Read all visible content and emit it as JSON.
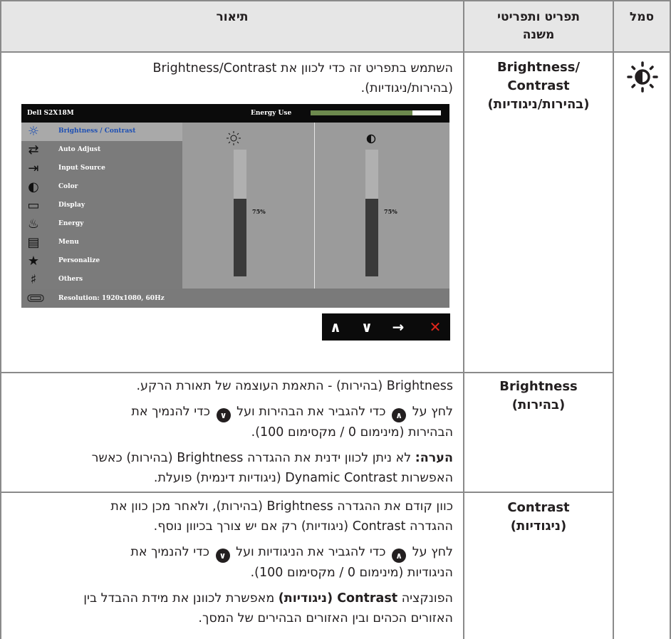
{
  "header": {
    "symbol": "סמל",
    "menu_line1": "תפריט ותפריטי",
    "menu_line2": "משנה",
    "description": "תיאור"
  },
  "rows": {
    "brightness_contrast": {
      "name_line1": "Brightness/",
      "name_line2": "Contrast",
      "name_line3": "(בהירות/ניגודיות)",
      "desc_line1": "השתמש בתפריט זה כדי לכוון את Brightness/Contrast",
      "desc_line2": "(בהירות/ניגודיות)."
    },
    "brightness": {
      "name_line1": "Brightness",
      "name_line2": "(בהירות)",
      "p1": "Brightness (בהירות) - התאמת העוצמה של תאורת הרקע.",
      "p2_a": "לחץ על",
      "p2_b": "כדי להגביר את הבהירות ועל",
      "p2_c": "כדי להנמיך את",
      "p2_line2": "הבהירות (מינימום 0 / מקסימום 100).",
      "note_bold": "הערה:",
      "note_line1": "לא ניתן לכוון ידנית את ההגדרה Brightness (בהירות) כאשר",
      "note_line2": "האפשרות Dynamic Contrast (ניגודיות דינמית) פועלת."
    },
    "contrast": {
      "name_line1": "Contrast",
      "name_line2": "(ניגודיות)",
      "p1_line1": "כוון קודם את ההגדרה Brightness (בהירות), ולאחר מכן כוון את",
      "p1_line2": "ההגדרה Contrast (ניגודיות) רק אם יש צורך בכיוון נוסף.",
      "p2_a": "לחץ על",
      "p2_b": "כדי להגביר את הניגודיות ועל",
      "p2_c": "כדי להנמיך את",
      "p2_line2": "הניגודיות (מינימום 0 / מקסימום 100).",
      "p3_a": "הפונקציה",
      "p3_bold": "Contrast (ניגודיות)",
      "p3_b": "מאפשרת לכוונן את מידת ההבדל בין",
      "p3_line2": "האזורים הכהים ובין האזורים הבהירים של המסך."
    }
  },
  "osd": {
    "model": "Dell S2X18M",
    "energy_use": "Energy Use",
    "energy_level": 0.78,
    "menu_items": [
      {
        "label": "Brightness / Contrast",
        "icon": "brightness-icon",
        "glyph": "☼"
      },
      {
        "label": "Auto Adjust",
        "icon": "auto-adjust-icon",
        "glyph": "⇄"
      },
      {
        "label": "Input Source",
        "icon": "input-source-icon",
        "glyph": "⇥"
      },
      {
        "label": "Color",
        "icon": "color-icon",
        "glyph": "◐"
      },
      {
        "label": "Display",
        "icon": "display-icon",
        "glyph": "▭"
      },
      {
        "label": "Energy",
        "icon": "energy-icon",
        "glyph": "♨"
      },
      {
        "label": "Menu",
        "icon": "menu-icon",
        "glyph": "▤"
      },
      {
        "label": "Personalize",
        "icon": "star-icon",
        "glyph": "★"
      },
      {
        "label": "Others",
        "icon": "others-icon",
        "glyph": "♯"
      }
    ],
    "brightness_value": "75%",
    "brightness_level": 0.75,
    "contrast_value": "75%",
    "contrast_level": 0.75,
    "resolution": "Resolution: 1920x1080, 60Hz",
    "nav": {
      "up": "∧",
      "down": "∨",
      "enter": "→",
      "exit": "✕"
    }
  },
  "colors": {
    "header_bg": "#e6e6e6",
    "grid": "#8a8a8a",
    "osd_selected_text": "#1e50b4",
    "exit_red": "#e0261b"
  }
}
